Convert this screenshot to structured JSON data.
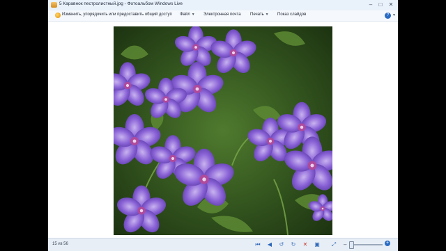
{
  "window": {
    "title": "5 Каравнок пестролистный.jpg - Фотоальбом Windows Live",
    "controls": {
      "minimize": "–",
      "maximize": "□",
      "close": "✕"
    }
  },
  "menu": {
    "fix_label": "Изменить, упорядочить или предоставить общий доступ",
    "items": [
      {
        "label": "Файл",
        "has_caret": true
      },
      {
        "label": "Электронная почта",
        "has_caret": false
      },
      {
        "label": "Печать",
        "has_caret": true
      },
      {
        "label": "Показ слайдов",
        "has_caret": false
      }
    ],
    "help_symbol": "?"
  },
  "photo": {
    "subject": "purple geranium flowers",
    "icon": "photo-icon"
  },
  "status": {
    "page_counter": "15 из 56",
    "toolbar": {
      "first": "⏮",
      "prev": "◀",
      "rotate_left": "↺",
      "rotate_right": "↻",
      "delete": "✕",
      "slideshow": "▣",
      "actual_size": "⤢"
    },
    "zoom": {
      "minus": "–",
      "plus": "+"
    }
  }
}
